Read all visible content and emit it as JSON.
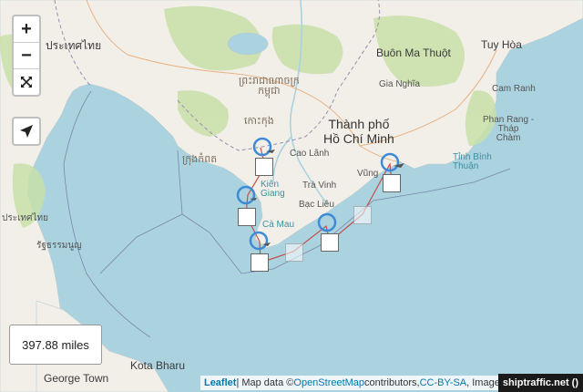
{
  "map": {
    "labels": {
      "bangkok_th": "ประเทศไทย",
      "buon_ma_thuot": "Buôn Ma Thuột",
      "tuy_hoa": "Tuy Hòa",
      "gia_nghia": "Gia Nghĩa",
      "cam_ranh": "Cam Ranh",
      "phan_rang": "Phan Rang -\nTháp\nChàm",
      "binh_thuan": "Tỉnh Bình\nThuận",
      "hcmc": "Thành phố\nHồ Chí Minh",
      "cambodia_kh": "ព្រះរាជាណាចក្រ\nកម្ពុជា",
      "cao_lanh": "Cao Lãnh",
      "vung_tau": "Vũng",
      "tra_vinh": "Trà Vinh",
      "bac_lieu": "Bạc Liêu",
      "kien_giang": "Kiên\nGiang",
      "ca_mau": "Cà Mau",
      "kota_bharu": "Kota Bharu",
      "george_town": "George Town",
      "thai_west_1": "ประเทศไทย",
      "thai_west_2": "รัฐธรรมนูญ",
      "khmer_small_1": "ក្រុងកំពត",
      "khmer_small_2": "កោះកុង"
    },
    "controls": {
      "zoom_in": "+",
      "zoom_out": "−",
      "fullscreen_icon": "fullscreen-icon",
      "locate_icon": "locate-arrow-icon"
    },
    "scale": "397.88 miles",
    "attribution": {
      "leaflet": "Leaflet",
      "sep1": " | Map data © ",
      "osm": "OpenStreetMap",
      "mid": " contributors, ",
      "license": "CC-BY-SA",
      "tail": ", Imagery"
    },
    "badge": "shiptraffic.net ()",
    "colors": {
      "water": "#aad3df",
      "land": "#f2efe9",
      "forest": "#c8dfa8",
      "border": "#9b8db0",
      "route": "#c0504d",
      "marker": "#3d8bd6",
      "link": "#0078a8"
    }
  }
}
